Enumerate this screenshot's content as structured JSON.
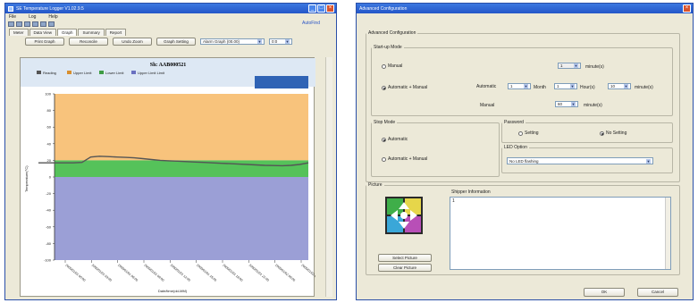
{
  "left_window": {
    "title": "SE Temperature Logger V1.02.9.5",
    "menu": [
      "File",
      "Log",
      "Help"
    ],
    "status_link": "AutoFind",
    "tabs": [
      "Meter",
      "Data View",
      "Graph",
      "Summary",
      "Report"
    ],
    "active_tab": 2,
    "toolbar_buttons": [
      "Print Graph",
      "Reconcile",
      "Undo Zoom",
      "Graph Setting"
    ],
    "dropdown_value": "Alarm Graph (00.00)",
    "dropdown_small": "0:0",
    "graph_title": "Sh: AAB000521",
    "legend": [
      "Reading",
      "Upper Limit",
      "Lower Limit",
      "Upper Limit Limit"
    ],
    "y_axis_label": "Temperature(°C)",
    "x_axis_label": "Date/time(dd-MM)",
    "y_ticks": [
      "100",
      "80",
      "60",
      "40",
      "20",
      "0",
      "-20",
      "-40",
      "-60",
      "-80",
      "-100"
    ],
    "x_ticks": [
      "2000/01/01 00:00",
      "2000/01/01 03:00",
      "2000/01/01 06:00",
      "2000/01/01 09:00",
      "2000/01/01 12:00",
      "2000/01/01 15:00",
      "2000/01/01 18:00",
      "2000/01/01 21:00",
      "2000/01/02 00:00",
      "2000/01/02 03:00"
    ],
    "colors": {
      "upper_band": "#f8c37c",
      "normal_band": "#55c25a",
      "lower_band": "#9b9fd6",
      "line": "#555555"
    },
    "reading_series": [
      17,
      17,
      17,
      17,
      17,
      17.5,
      24,
      25,
      24.5,
      24,
      23.5,
      23,
      22,
      21,
      20,
      19.5,
      19,
      18.5,
      18,
      17.5,
      17,
      16.5,
      16,
      15.5,
      15,
      14.5,
      14,
      13.8,
      13.6,
      14,
      15,
      17
    ]
  },
  "right_window": {
    "title": "Advanced Configuration",
    "group_title": "Advanced Configuration",
    "startup": {
      "legend": "Start-up Mode",
      "manual_label": "Manual",
      "auto_manual_label": "Automatic + Manual",
      "manual_value": "1",
      "minute_label": "minute(s)",
      "automatic_label": "Automatic",
      "month_label": "Month",
      "month_value": "1",
      "hour_label": "Hour(s)",
      "hour_value": "1",
      "minutes_value": "10",
      "minutes_label": "minute(s)",
      "manual2_label": "Manual",
      "manual2_value": "60",
      "minute2_label": "minute(s)"
    },
    "stop": {
      "legend": "Stop Mode",
      "automatic_label": "Automatic",
      "auto_manual_label": "Automatic + Manual"
    },
    "password": {
      "legend": "Password",
      "setting_label": "Setting",
      "no_setting_label": "No Setting"
    },
    "led": {
      "legend": "LED Option",
      "value": "No LED flashing"
    },
    "picture": {
      "legend": "Picture",
      "select_label": "Select Picture",
      "clear_label": "Clear Picture"
    },
    "shipper": {
      "legend": "Shipper Information",
      "text": "1"
    },
    "ok_label": "OK",
    "cancel_label": "Cancel"
  }
}
